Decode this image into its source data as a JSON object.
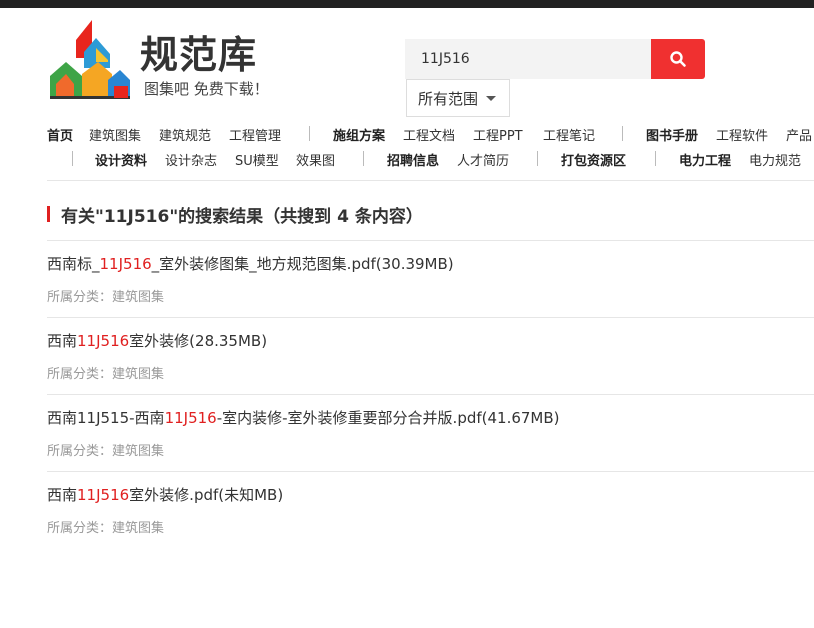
{
  "brand": {
    "name": "规范库",
    "slogan": "图集吧  免费下载！"
  },
  "search": {
    "query": "11J516",
    "scope": "所有范围"
  },
  "nav_row1": [
    "首页",
    "建筑图集",
    "建筑规范",
    "工程管理",
    "施组方案",
    "工程文档",
    "工程PPT",
    "工程笔记",
    "图书手册",
    "工程软件",
    "产品"
  ],
  "nav_row2": [
    "设计资料",
    "设计杂志",
    "SU模型",
    "效果图",
    "招聘信息",
    "人才简历",
    "打包资源区",
    "电力工程",
    "电力规范"
  ],
  "results_heading": "有关\"11J516\"的搜索结果（共搜到 4 条内容）",
  "results": [
    {
      "pre": "西南标_",
      "hl": "11J516",
      "post": "_室外装修图集_地方规范图集.pdf(30.39MB)",
      "category": "所属分类：建筑图集"
    },
    {
      "pre": "西南",
      "hl": "11J516",
      "post": "室外装修(28.35MB)",
      "category": "所属分类：建筑图集"
    },
    {
      "pre": "西南11J515-西南",
      "hl": "11J516",
      "post": "-室内装修-室外装修重要部分合并版.pdf(41.67MB)",
      "category": "所属分类：建筑图集"
    },
    {
      "pre": "西南",
      "hl": "11J516",
      "post": "室外装修.pdf(未知MB)",
      "category": "所属分类：建筑图集"
    }
  ],
  "colors": {
    "accent": "#f03030",
    "highlight": "#e02020"
  }
}
